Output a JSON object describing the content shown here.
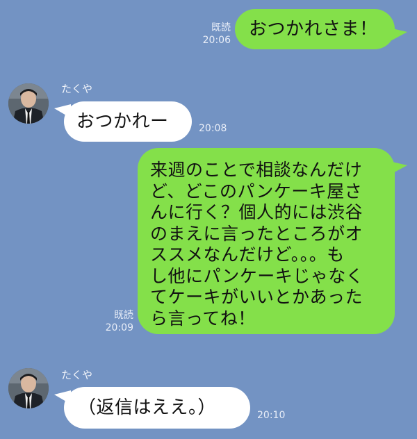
{
  "messages": [
    {
      "sender": "me",
      "read_label": "既読",
      "time": "20:06",
      "text": "おつかれさま！"
    },
    {
      "sender": "たくや",
      "time": "20:08",
      "text": "おつかれー"
    },
    {
      "sender": "me",
      "read_label": "既読",
      "time": "20:09",
      "text": "来週のことで相談なんだけ\nど、どこのパンケーキ屋さ\nんに行く？個人的には渋谷\nのまえに言ったところがオ\nススメなんだけど。。。も\nし他にパンケーキじゃなく\nてケーキがいいとかあった\nら言ってね！"
    },
    {
      "sender": "たくや",
      "time": "20:10",
      "text": "（返信はええ。）"
    }
  ],
  "contact": {
    "name": "たくや",
    "avatar_icon": "profile-photo-icon"
  },
  "colors": {
    "background": "#7393c3",
    "outgoing_bubble": "#84e04a",
    "incoming_bubble": "#ffffff"
  }
}
